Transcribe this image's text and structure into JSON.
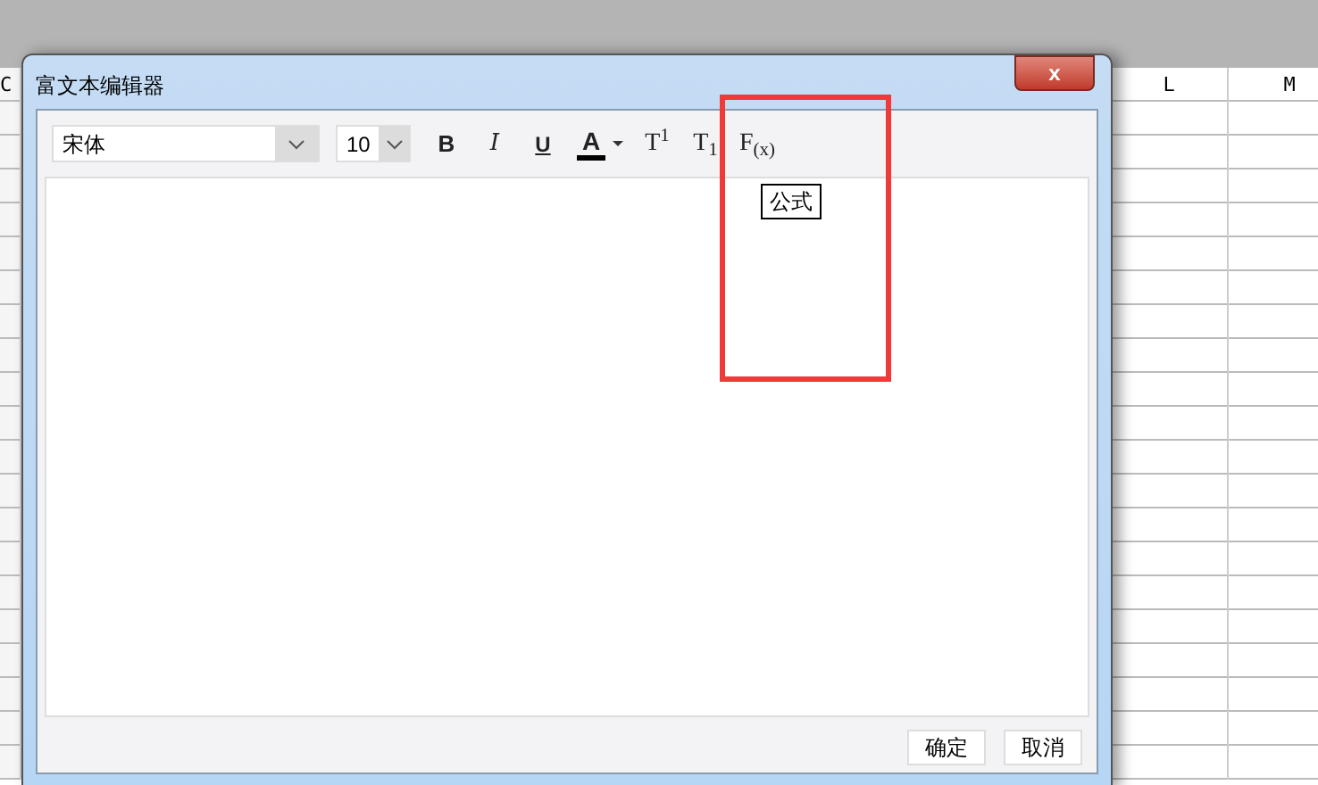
{
  "sheet": {
    "columns": [
      {
        "label": "C"
      },
      {
        "label": "L"
      },
      {
        "label": "M"
      }
    ]
  },
  "dialog": {
    "title": "富文本编辑器",
    "close": "x",
    "toolbar": {
      "font": "宋体",
      "size": "10",
      "tools": [
        {
          "kind": "bold",
          "label": "B"
        },
        {
          "kind": "italic",
          "label": "I"
        },
        {
          "kind": "underline",
          "label": "U"
        },
        {
          "kind": "color",
          "label": "A"
        },
        {
          "kind": "serif",
          "label": "T$^{1}$"
        },
        {
          "kind": "serif",
          "label": "T$_{1}$"
        },
        {
          "kind": "serif",
          "label": "F$_{(x)}$"
        }
      ]
    },
    "tooltip": "公式",
    "buttons": [
      "确定",
      "取消"
    ]
  }
}
